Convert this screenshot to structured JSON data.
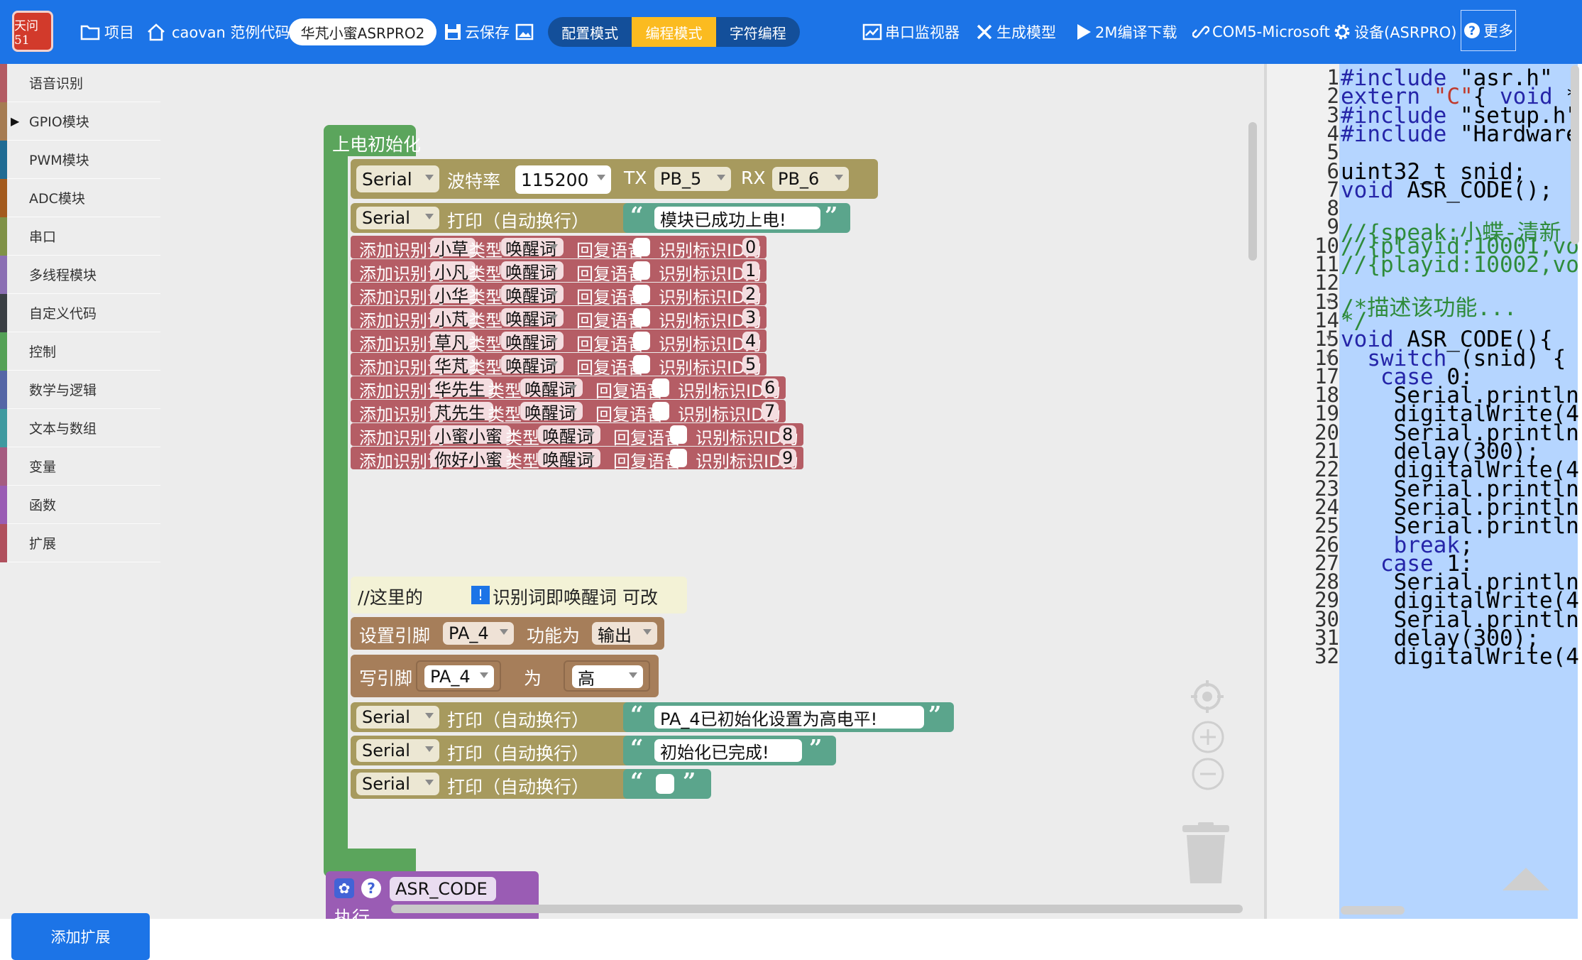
{
  "toolbar": {
    "logo_text": "天问51",
    "project": "项目",
    "example": "caovan 范例代码",
    "board": "华芃小蜜ASRPRO2",
    "cloud_save": "云保存",
    "modes": [
      "配置模式",
      "编程模式",
      "字符编程"
    ],
    "active_mode_index": 1,
    "serial_monitor": "串口监视器",
    "gen_model": "生成模型",
    "compile_download": "2M编译下载",
    "port": "COM5-Microsoft",
    "device": "设备(ASRPRO)",
    "more": "更多",
    "colors": {
      "bar": "#1c74e7",
      "active_mode": "#fbbb20"
    }
  },
  "sidebar": {
    "categories": [
      {
        "label": "语音识别",
        "color": "#b35b63",
        "expanded": false
      },
      {
        "label": "GPIO模块",
        "color": "#a67c52",
        "expanded": true
      },
      {
        "label": "PWM模块",
        "color": "#1f6b93",
        "expanded": false
      },
      {
        "label": "ADC模块",
        "color": "#a35a1d",
        "expanded": false
      },
      {
        "label": "串口",
        "color": "#7f9146",
        "expanded": false
      },
      {
        "label": "多线程模块",
        "color": "#8b6fb3",
        "expanded": false
      },
      {
        "label": "自定义代码",
        "color": "#3a3f44",
        "expanded": false
      },
      {
        "label": "控制",
        "color": "#54a156",
        "expanded": false
      },
      {
        "label": "数学与逻辑",
        "color": "#5566a6",
        "expanded": false
      },
      {
        "label": "文本与数组",
        "color": "#3f9aa0",
        "expanded": false
      },
      {
        "label": "变量",
        "color": "#a55b80",
        "expanded": false
      },
      {
        "label": "函数",
        "color": "#9a5cb4",
        "expanded": false
      },
      {
        "label": "扩展",
        "color": "#b0505d",
        "expanded": false
      }
    ],
    "add_extension": "添加扩展"
  },
  "workspace": {
    "setup_block": {
      "title": "上电初始化",
      "serial_begin": {
        "obj": "Serial",
        "label": "波特率",
        "baud": "115200",
        "tx_label": "TX",
        "tx": "PB_5",
        "rx_label": "RX",
        "rx": "PB_6"
      },
      "print1": {
        "obj": "Serial",
        "label": "打印（自动换行）",
        "text": "模块已成功上电!"
      },
      "words": [
        {
          "prefix": "添加识别词",
          "word": "小草",
          "type_label": "类型",
          "type": "唤醒词",
          "reply": "回复语音",
          "id_label": "识别标识ID为",
          "id": "0"
        },
        {
          "prefix": "添加识别词",
          "word": "小凡",
          "type_label": "类型",
          "type": "唤醒词",
          "reply": "回复语音",
          "id_label": "识别标识ID为",
          "id": "1"
        },
        {
          "prefix": "添加识别词",
          "word": "小华",
          "type_label": "类型",
          "type": "唤醒词",
          "reply": "回复语音",
          "id_label": "识别标识ID为",
          "id": "2"
        },
        {
          "prefix": "添加识别词",
          "word": "小芃",
          "type_label": "类型",
          "type": "唤醒词",
          "reply": "回复语音",
          "id_label": "识别标识ID为",
          "id": "3"
        },
        {
          "prefix": "添加识别词",
          "word": "草凡",
          "type_label": "类型",
          "type": "唤醒词",
          "reply": "回复语音",
          "id_label": "识别标识ID为",
          "id": "4"
        },
        {
          "prefix": "添加识别词",
          "word": "华芃",
          "type_label": "类型",
          "type": "唤醒词",
          "reply": "回复语音",
          "id_label": "识别标识ID为",
          "id": "5"
        },
        {
          "prefix": "添加识别词",
          "word": "华先生",
          "type_label": "类型",
          "type": "唤醒词",
          "reply": "回复语音",
          "id_label": "识别标识ID为",
          "id": "6"
        },
        {
          "prefix": "添加识别词",
          "word": "芃先生",
          "type_label": "类型",
          "type": "唤醒词",
          "reply": "回复语音",
          "id_label": "识别标识ID为",
          "id": "7"
        },
        {
          "prefix": "添加识别词",
          "word": "小蜜小蜜",
          "type_label": "类型",
          "type": "唤醒词",
          "reply": "回复语音",
          "id_label": "识别标识ID为",
          "id": "8"
        },
        {
          "prefix": "添加识别词",
          "word": "你好小蜜",
          "type_label": "类型",
          "type": "唤醒词",
          "reply": "回复语音",
          "id_label": "识别标识ID为",
          "id": "9"
        }
      ],
      "comment": {
        "prefix": "//这里的",
        "text": "识别词即唤醒词 可改"
      },
      "pin_mode": {
        "label": "设置引脚",
        "pin": "PA_4",
        "func_label": "功能为",
        "mode": "输出"
      },
      "digital_write": {
        "label": "写引脚",
        "pin": "PA_4",
        "as_label": "为",
        "value": "高"
      },
      "print2": {
        "obj": "Serial",
        "label": "打印（自动换行）",
        "text": "PA_4已初始化设置为高电平!"
      },
      "print3": {
        "obj": "Serial",
        "label": "打印（自动换行）",
        "text": "初始化已完成!"
      },
      "print4": {
        "obj": "Serial",
        "label": "打印（自动换行）",
        "text": ""
      }
    },
    "func_block": {
      "name": "ASR_CODE",
      "exec_label": "执行"
    },
    "colors": {
      "control": "#5ba55c",
      "speech": "#b55d65",
      "serial": "#a79a5e",
      "gpio": "#a67e5a",
      "text": "#5ba58c",
      "comment": "#f3f2d6"
    }
  },
  "editor": {
    "lines": [
      "#include \"asr.h\"",
      "extern \"C\"{ void *",
      "#include \"setup.h\"",
      "#include \"Hardware",
      "",
      "uint32_t snid;",
      "void ASR_CODE();",
      "",
      "//{speak:小蝶-清新",
      "//{playid:10001,vo",
      "//{playid:10002,vo",
      "",
      "/*描述该功能...",
      "*/",
      "void ASR_CODE(){",
      "  switch (snid) {",
      "   case 0:",
      "    Serial.println",
      "    digitalWrite(4",
      "    Serial.println",
      "    delay(300);",
      "    digitalWrite(4",
      "    Serial.println",
      "    Serial.println",
      "    Serial.println",
      "    break;",
      "   case 1:",
      "    Serial.println",
      "    digitalWrite(4",
      "    Serial.println",
      "    delay(300);",
      "    digitalWrite(4"
    ],
    "fold_lines": [
      13,
      15,
      16
    ]
  }
}
